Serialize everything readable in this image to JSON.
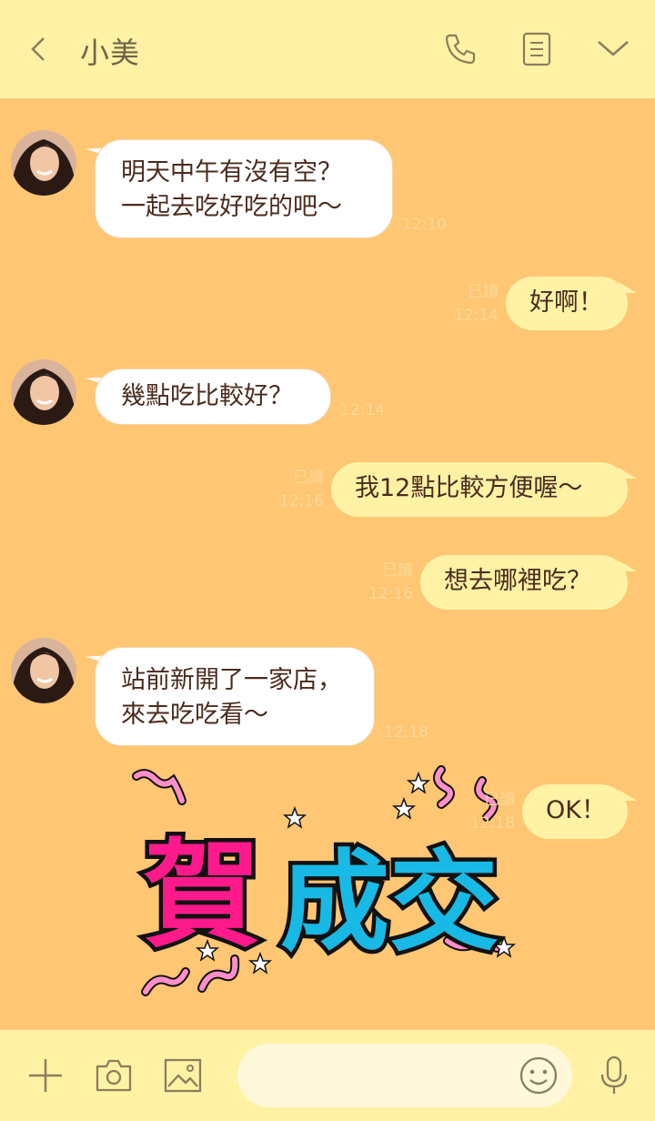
{
  "header": {
    "title": "小美",
    "icons": [
      "back-icon",
      "phone-icon",
      "notes-icon",
      "chevron-down-icon"
    ]
  },
  "messages": [
    {
      "side": "left",
      "text": "明天中午有沒有空？\n一起去吃好吃的吧～",
      "time": "12:10"
    },
    {
      "side": "right",
      "text": "好啊！",
      "read": "已讀",
      "time": "12:14"
    },
    {
      "side": "left",
      "text": "幾點吃比較好？",
      "time": "12:14"
    },
    {
      "side": "right",
      "text": "我12點比較方便喔～",
      "read": "已讀",
      "time": "12:16"
    },
    {
      "side": "right",
      "text": "想去哪裡吃？",
      "read": "已讀",
      "time": "12:16"
    },
    {
      "side": "left",
      "text": "站前新開了一家店，\n來去吃吃看～",
      "time": "12:18"
    },
    {
      "side": "right",
      "text": "OK！",
      "read": "已讀",
      "time": "12:18"
    }
  ],
  "sticker": {
    "text_pink": "賀",
    "text_blue": "成交"
  },
  "footer": {
    "icons": [
      "plus-icon",
      "camera-icon",
      "image-icon",
      "emoji-icon",
      "mic-icon"
    ],
    "input_placeholder": ""
  },
  "colors": {
    "header_bg": "#fff2a5",
    "chat_bg": "#ffc673",
    "my_bubble": "#fff2a5",
    "their_bubble": "#ffffff",
    "sticker_pink": "#ff1a8c",
    "sticker_blue": "#19b9e6"
  }
}
